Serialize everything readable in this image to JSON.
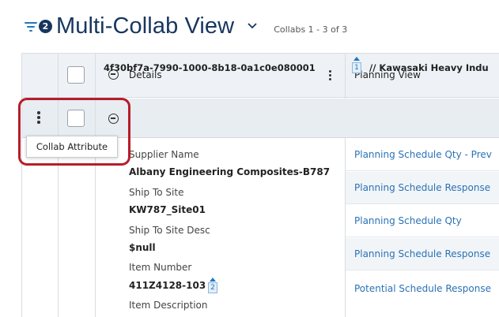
{
  "header": {
    "filter_count": "2",
    "title": "Multi-Collab View",
    "collab_count": "Collabs 1 - 3 of 3"
  },
  "table": {
    "col_details": "Details",
    "col_planning": "Planning View",
    "group": {
      "id": "4f30bf7a-7990-1000-8b18-0a1c0e080001",
      "sort_badge": "1",
      "name": "// Kawasaki Heavy Indu"
    },
    "attributes": [
      {
        "label": "Supplier Name",
        "value": "Albany Engineering Composites-B787"
      },
      {
        "label": "Ship To Site",
        "value": "KW787_Site01"
      },
      {
        "label": "Ship To Site Desc",
        "value": "$null"
      },
      {
        "label": "Item Number",
        "value": "411Z4128-103",
        "badge": "2"
      },
      {
        "label": "Item Description"
      }
    ],
    "planning_rows": [
      "Planning Schedule Qty - Prev",
      "Planning Schedule Response",
      "Planning Schedule Qty",
      "Planning Schedule Response",
      "Potential Schedule Response"
    ]
  },
  "tooltip": "Collab Attribute",
  "colors": {
    "title": "#17365e",
    "link": "#2a72b5",
    "highlight": "#b71c2a",
    "header_bg": "#eef2f6"
  },
  "icons": [
    "filter-icon",
    "chevron-down-icon",
    "kebab-icon",
    "collapse-icon",
    "sort-icon"
  ]
}
